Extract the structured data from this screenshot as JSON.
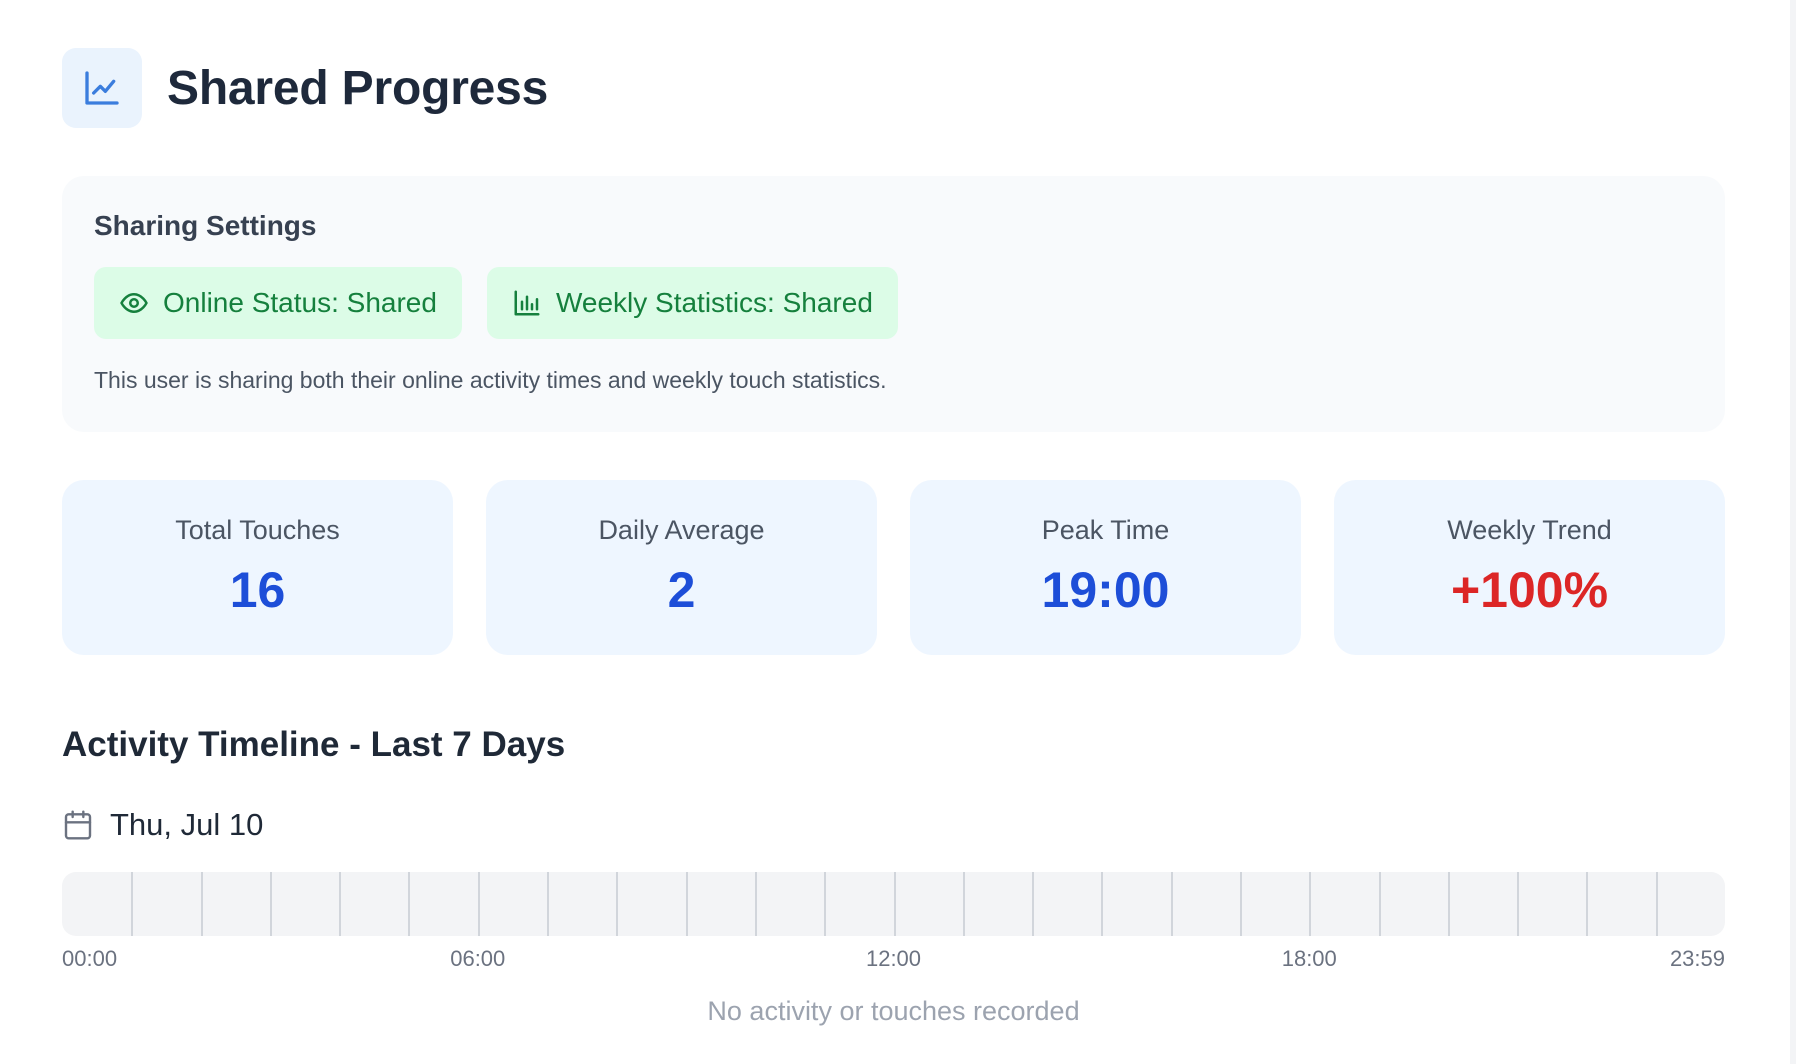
{
  "header": {
    "title": "Shared Progress",
    "icon": "line-chart-icon"
  },
  "sharing": {
    "title": "Sharing Settings",
    "chips": [
      {
        "label": "Online Status: Shared",
        "icon": "eye-icon"
      },
      {
        "label": "Weekly Statistics: Shared",
        "icon": "bar-chart-icon"
      }
    ],
    "description": "This user is sharing both their online activity times and weekly touch statistics."
  },
  "stats": [
    {
      "label": "Total Touches",
      "value": "16"
    },
    {
      "label": "Daily Average",
      "value": "2"
    },
    {
      "label": "Peak Time",
      "value": "19:00"
    },
    {
      "label": "Weekly Trend",
      "value": "+100%"
    }
  ],
  "timeline": {
    "title": "Activity Timeline - Last 7 Days",
    "day": {
      "label": "Thu, Jul 10",
      "icon": "calendar-icon",
      "axis": [
        "00:00",
        "06:00",
        "12:00",
        "18:00",
        "23:59"
      ],
      "empty_message": "No activity or touches recorded"
    }
  },
  "colors": {
    "accent": "#1d4ed8",
    "shared_bg": "#dcfce7",
    "shared_text": "#15803d",
    "trend_positive": "#dc2626"
  }
}
